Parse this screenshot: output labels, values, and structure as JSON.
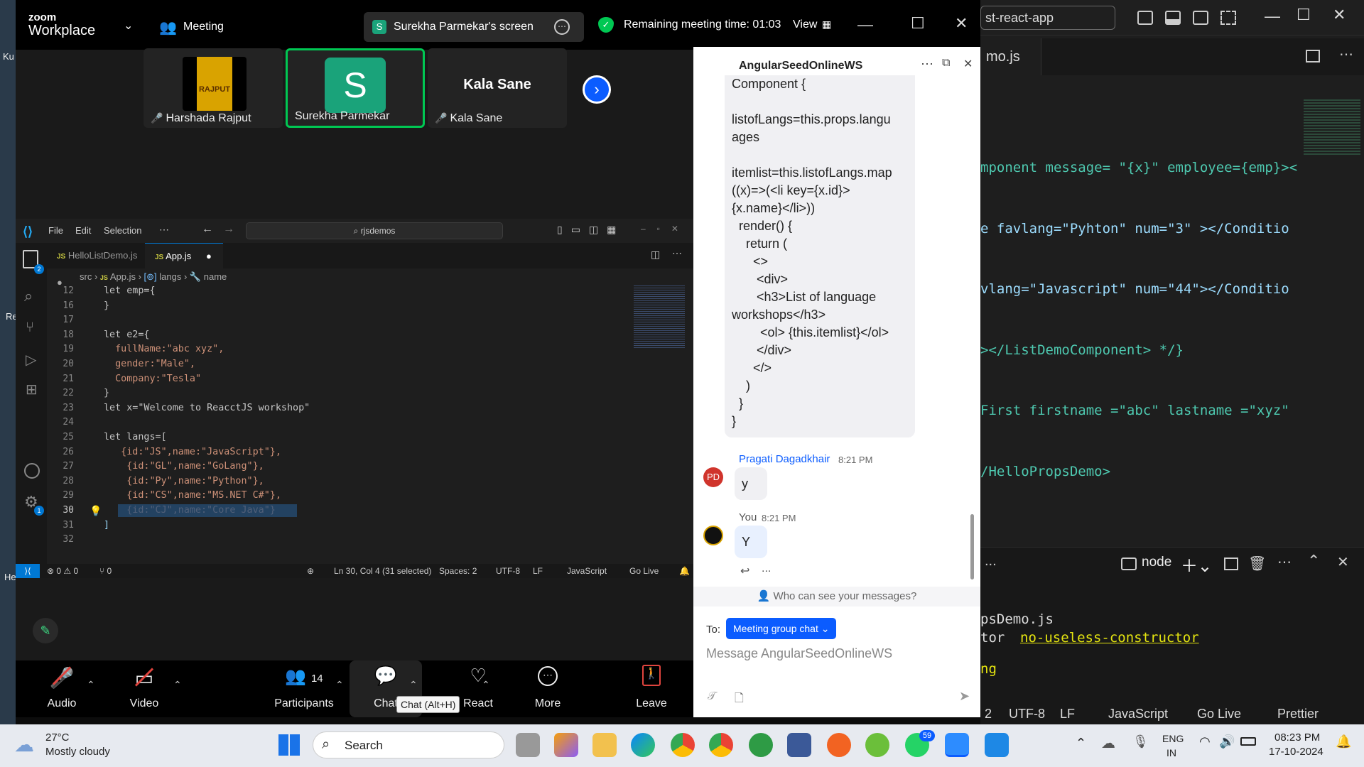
{
  "bg_vscode": {
    "search_fragment": "st-react-app",
    "tab_label": "mo.js",
    "code_lines": [
      "mponent message= \"{x}\" employee={emp}><",
      "e favlang=\"Pyhton\" num=\"3\" ></Conditio",
      "vlang=\"Javascript\" num=\"44\"></Conditio",
      "></ListDemoComponent> */}",
      "First firstname =\"abc\" lastname =\"xyz\"",
      "/HelloPropsDemo>"
    ],
    "terminal_label": "node",
    "terminal_ellipsis": "...",
    "terminal_lines": [
      "psDemo.js",
      "tor",
      "no-useless-constructor",
      "ng"
    ],
    "status": [
      "2",
      "UTF-8",
      "LF",
      "JavaScript",
      "Go Live",
      "Prettier"
    ]
  },
  "zoom": {
    "logo_top": "zoom",
    "logo_bottom": "Workplace",
    "meeting_label": "Meeting",
    "share_avatar": "S",
    "share_label": "Surekha Parmekar's screen",
    "remaining": "Remaining meeting time: 01:03",
    "view_label": "View",
    "participants": [
      {
        "name": "Harshada Rajput",
        "avatar_text": "RAJPUT"
      },
      {
        "name": "Surekha Parmekar",
        "avatar_text": "S"
      },
      {
        "name": "Kala Sane",
        "avatar_text": "Kala Sane"
      }
    ],
    "toolbar": {
      "audio": "Audio",
      "video": "Video",
      "participants": "Participants",
      "participants_count": "14",
      "chat": "Chat",
      "react": "React",
      "more": "More",
      "leave": "Leave",
      "chat_tooltip": "Chat (Alt+H)"
    }
  },
  "vscode": {
    "menu": [
      "File",
      "Edit",
      "Selection",
      "⋯"
    ],
    "search": "rjsdemos",
    "tabs": [
      {
        "label": "HelloListDemo.js",
        "prefix": "JS"
      },
      {
        "label": "App.js",
        "prefix": "JS"
      }
    ],
    "breadcrumb": [
      "src",
      "App.js",
      "langs",
      "name"
    ],
    "js_prefix": "JS",
    "explorer_badge": "2",
    "settings_badge": "1",
    "line_numbers": [
      "12",
      "16",
      "17",
      "18",
      "19",
      "20",
      "21",
      "22",
      "23",
      "24",
      "25",
      "26",
      "27",
      "28",
      "29",
      "30",
      "31",
      "32"
    ],
    "code": [
      "let emp={",
      "}",
      "",
      "let e2={",
      "  fullName:\"abc xyz\",",
      "  gender:\"Male\",",
      "  Company:\"Tesla\"",
      "}",
      "let x=\"Welcome to ReacctJS workshop\"",
      "",
      "let langs=[",
      "   {id:\"JS\",name:\"JavaScript\"},",
      "    {id:\"GL\",name:\"GoLang\"},",
      "    {id:\"Py\",name:\"Python\"},",
      "    {id:\"CS\",name:\"MS.NET C#\"},",
      "    {id:\"CJ\",name:\"Core Java\"}",
      "]",
      ""
    ],
    "status": {
      "problems": "⊗ 0 ⚠ 0",
      "ports": "⑂ 0",
      "position": "Ln 30, Col 4 (31 selected)",
      "spaces": "Spaces: 2",
      "encoding": "UTF-8",
      "eol": "LF",
      "language": "JavaScript",
      "golive": "Go Live"
    }
  },
  "chat": {
    "title": "AngularSeedOnlineWS",
    "code_message": [
      "Component {",
      "",
      "listofLangs=this.props.langu",
      "ages",
      "",
      "itemlist=this.listofLangs.map",
      "((x)=>(<li key={x.id}>",
      "{x.name}</li>))",
      "  render() {",
      "    return (",
      "      <>",
      "       <div>",
      "       <h3>List of language",
      "workshops</h3>",
      "        <ol> {this.itemlist}</ol>",
      "       </div>",
      "      </>",
      "    )",
      "  }",
      "}"
    ],
    "msg1_sender": "Pragati Dagadkhair",
    "msg1_time": "8:21 PM",
    "msg1_avatar": "PD",
    "msg1_text": "y",
    "msg2_sender": "You",
    "msg2_time": "8:21 PM",
    "msg2_text": "Y",
    "msg_actions": "...",
    "who_can_see": "Who can see your messages?",
    "to_label": "To:",
    "recipient": "Meeting group chat",
    "placeholder": "Message AngularSeedOnlineWS"
  },
  "taskbar": {
    "temp": "27°C",
    "weather": "Mostly cloudy",
    "search": "Search",
    "whatsapp_badge": "59",
    "lang1": "ENG",
    "lang2": "IN",
    "time": "08:23 PM",
    "date": "17-10-2024"
  },
  "desktop": {
    "edge_text1": "Ku",
    "edge_text2": "Re",
    "edge_text3": "He"
  },
  "colors": {
    "accent": "#0b5cff",
    "zoom_green": "#00c853",
    "vscode_blue": "#007acc",
    "selection": "#264f78"
  }
}
